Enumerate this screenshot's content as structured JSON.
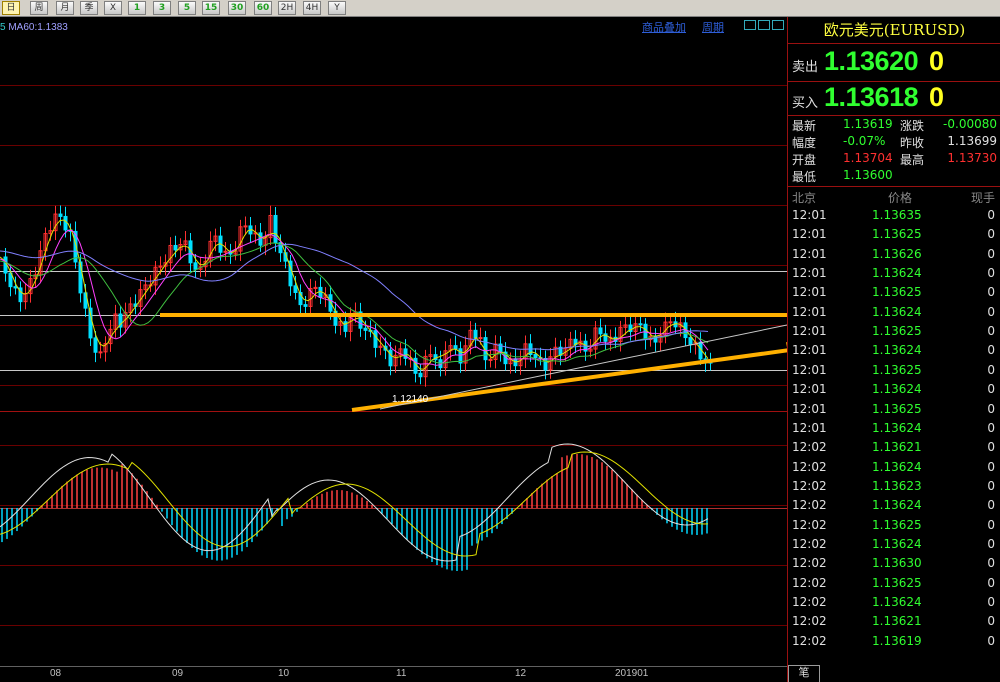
{
  "toolbar": {
    "buttons": [
      {
        "label": "日",
        "icon": "day-period-icon",
        "selected": true
      },
      {
        "label": "周",
        "icon": "week-period-icon"
      },
      {
        "label": "月",
        "icon": "month-period-icon"
      },
      {
        "label": "季",
        "icon": "quarter-period-icon"
      },
      {
        "label": "X",
        "icon": "year-period-icon"
      },
      {
        "label": "1",
        "icon": "1min-icon"
      },
      {
        "label": "3",
        "icon": "3min-icon"
      },
      {
        "label": "5",
        "icon": "5min-icon"
      },
      {
        "label": "15",
        "icon": "15min-icon"
      },
      {
        "label": "30",
        "icon": "30min-icon"
      },
      {
        "label": "60",
        "icon": "60min-icon"
      },
      {
        "label": "2H",
        "icon": "2hour-icon"
      },
      {
        "label": "4H",
        "icon": "4hour-icon"
      },
      {
        "label": "Y",
        "icon": "year-icon"
      }
    ]
  },
  "chart_header": {
    "ma_label": "MA60:1.1383",
    "menu_overlay": "商品叠加",
    "menu_period": "周期"
  },
  "chart_data": [
    {
      "type": "candlestick",
      "title": "",
      "annotation": "1.12140",
      "x_ticks": [
        "08",
        "09",
        "10",
        "11",
        "12",
        "201901"
      ],
      "ma_legend": "MA60:1.1383",
      "note": "Candlestick price chart with moving averages, two horizontal resistance/support lines and an ascending triangle drawn with orange arrows"
    },
    {
      "type": "bar",
      "title": "",
      "note": "MACD histogram (red positive, cyan negative) with DIF and DEA lines"
    }
  ],
  "panel": {
    "title": "欧元美元(EURUSD)",
    "sell_label": "卖出",
    "sell_price": "1.13620",
    "sell_size": "0",
    "buy_label": "买入",
    "buy_price": "1.13618",
    "buy_size": "0",
    "stats": {
      "latest_label": "最新",
      "latest": "1.13619",
      "change_label": "涨跌",
      "change": "-0.00080",
      "range_label": "幅度",
      "range": "-0.07%",
      "prev_close_label": "昨收",
      "prev_close": "1.13699",
      "open_label": "开盘",
      "open": "1.13704",
      "high_label": "最高",
      "high": "1.13730",
      "low_label": "最低",
      "low": "1.13600"
    },
    "table_headers": {
      "time": "北京",
      "price": "价格",
      "volume": "现手"
    },
    "ticks": [
      {
        "time": "12:01",
        "price": "1.13635",
        "vol": "0"
      },
      {
        "time": "12:01",
        "price": "1.13625",
        "vol": "0"
      },
      {
        "time": "12:01",
        "price": "1.13626",
        "vol": "0"
      },
      {
        "time": "12:01",
        "price": "1.13624",
        "vol": "0"
      },
      {
        "time": "12:01",
        "price": "1.13625",
        "vol": "0"
      },
      {
        "time": "12:01",
        "price": "1.13624",
        "vol": "0"
      },
      {
        "time": "12:01",
        "price": "1.13625",
        "vol": "0"
      },
      {
        "time": "12:01",
        "price": "1.13624",
        "vol": "0"
      },
      {
        "time": "12:01",
        "price": "1.13625",
        "vol": "0"
      },
      {
        "time": "12:01",
        "price": "1.13624",
        "vol": "0"
      },
      {
        "time": "12:01",
        "price": "1.13625",
        "vol": "0"
      },
      {
        "time": "12:01",
        "price": "1.13624",
        "vol": "0"
      },
      {
        "time": "12:02",
        "price": "1.13621",
        "vol": "0"
      },
      {
        "time": "12:02",
        "price": "1.13624",
        "vol": "0"
      },
      {
        "time": "12:02",
        "price": "1.13623",
        "vol": "0"
      },
      {
        "time": "12:02",
        "price": "1.13624",
        "vol": "0"
      },
      {
        "time": "12:02",
        "price": "1.13625",
        "vol": "0"
      },
      {
        "time": "12:02",
        "price": "1.13624",
        "vol": "0"
      },
      {
        "time": "12:02",
        "price": "1.13630",
        "vol": "0"
      },
      {
        "time": "12:02",
        "price": "1.13625",
        "vol": "0"
      },
      {
        "time": "12:02",
        "price": "1.13624",
        "vol": "0"
      },
      {
        "time": "12:02",
        "price": "1.13621",
        "vol": "0"
      },
      {
        "time": "12:02",
        "price": "1.13619",
        "vol": "0"
      }
    ],
    "bottom_tab": "笔"
  },
  "colors": {
    "bull": "#ff3030",
    "bear": "#00e0ff",
    "price_up": "#30ff30",
    "title": "#ffff40",
    "arrow": "#ffb000"
  }
}
